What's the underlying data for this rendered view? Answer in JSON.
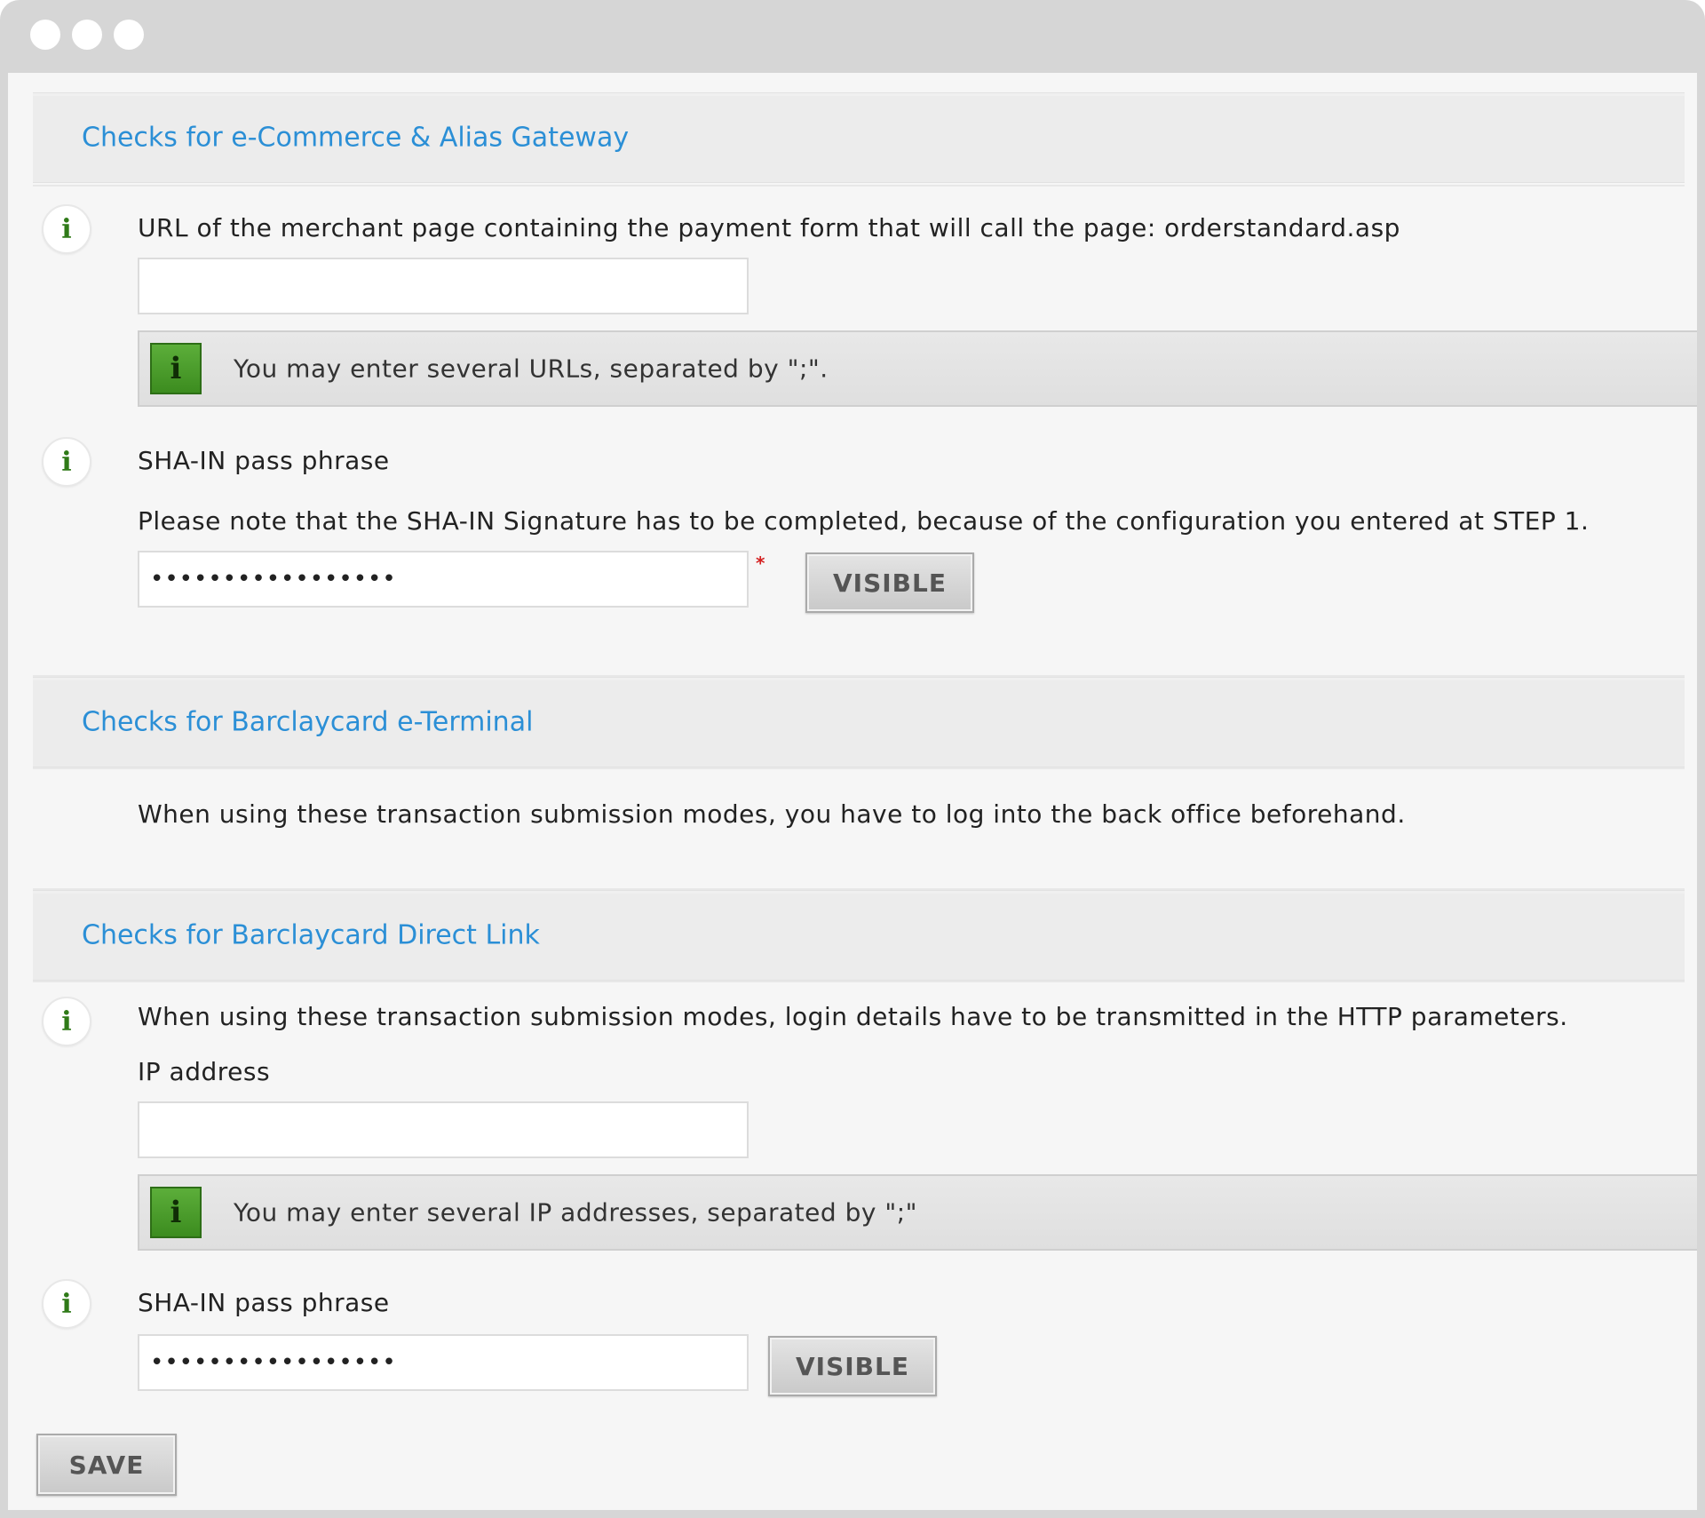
{
  "window": {
    "controls": [
      "close",
      "minimize",
      "zoom"
    ]
  },
  "sections": [
    {
      "title": "Checks for e-Commerce & Alias Gateway",
      "url_label": "URL of the merchant page containing the payment form that will call the page: orderstandard.asp",
      "url_value": "",
      "url_hint": "You may enter several URLs, separated by \";\".",
      "sha_label": "SHA-IN pass phrase",
      "sha_note": "Please note that the SHA-IN Signature has to be completed, because of the configuration you entered at STEP 1.",
      "sha_value": "•••••••••••••••••",
      "required_mark": "*",
      "visible_label": "VISIBLE"
    },
    {
      "title": "Checks for Barclaycard e-Terminal",
      "note": "When using these transaction submission modes, you have to log into the back office beforehand."
    },
    {
      "title": "Checks for Barclaycard Direct Link",
      "note": "When using these transaction submission modes, login details have to be transmitted in the HTTP parameters.",
      "ip_label": "IP address",
      "ip_value": "",
      "ip_hint": "You may enter several IP addresses, separated by \";\"",
      "sha_label": "SHA-IN pass phrase",
      "sha_value": "•••••••••••••••••",
      "visible_label": "VISIBLE"
    }
  ],
  "save_label": "SAVE",
  "icons": {
    "info": "i"
  },
  "colors": {
    "link": "#2b8fd6",
    "hint_icon": "#4a9e2c",
    "required": "#d42020"
  }
}
